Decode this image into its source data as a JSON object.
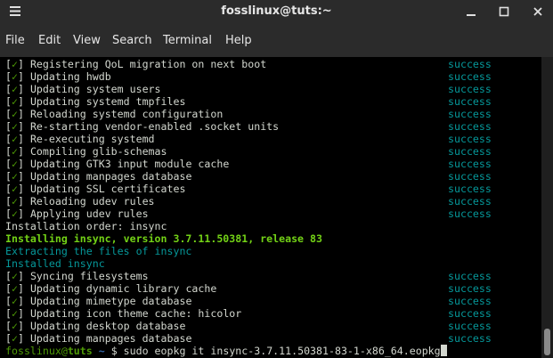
{
  "window": {
    "title": "fosslinux@tuts:~",
    "icons": {
      "menu": "hamburger-menu-icon",
      "minimize": "minimize-icon",
      "maximize": "maximize-icon",
      "close": "close-icon"
    }
  },
  "menubar": {
    "items": [
      "File",
      "Edit",
      "View",
      "Search",
      "Terminal",
      "Help"
    ]
  },
  "terminal": {
    "colors": {
      "status": "#06989a",
      "check": "#4e9a06",
      "highlight": "#73d216",
      "text": "#d3d7cf",
      "background": "#000000"
    },
    "lines_block1": [
      {
        "check": "✓",
        "text": "Registering QoL migration on next boot",
        "status": "success"
      },
      {
        "check": "✓",
        "text": "Updating hwdb",
        "status": "success"
      },
      {
        "check": "✓",
        "text": "Updating system users",
        "status": "success"
      },
      {
        "check": "✓",
        "text": "Updating systemd tmpfiles",
        "status": "success"
      },
      {
        "check": "✓",
        "text": "Reloading systemd configuration",
        "status": "success"
      },
      {
        "check": "✓",
        "text": "Re-starting vendor-enabled .socket units",
        "status": "success"
      },
      {
        "check": "✓",
        "text": "Re-executing systemd",
        "status": "success"
      },
      {
        "check": "✓",
        "text": "Compiling glib-schemas",
        "status": "success"
      },
      {
        "check": "✓",
        "text": "Updating GTK3 input module cache",
        "status": "success"
      },
      {
        "check": "✓",
        "text": "Updating manpages database",
        "status": "success"
      },
      {
        "check": "✓",
        "text": "Updating SSL certificates",
        "status": "success"
      },
      {
        "check": "✓",
        "text": "Reloading udev rules",
        "status": "success"
      },
      {
        "check": "✓",
        "text": "Applying udev rules",
        "status": "success"
      }
    ],
    "install_order": "Installation order: insync",
    "installing": "Installing insync, version 3.7.11.50381, release 83",
    "extracting": "Extracting the files of insync",
    "installed": "Installed insync",
    "lines_block2": [
      {
        "check": "✓",
        "text": "Syncing filesystems",
        "status": "success"
      },
      {
        "check": "✓",
        "text": "Updating dynamic library cache",
        "status": "success"
      },
      {
        "check": "✓",
        "text": "Updating mimetype database",
        "status": "success"
      },
      {
        "check": "✓",
        "text": "Updating icon theme cache: hicolor",
        "status": "success"
      },
      {
        "check": "✓",
        "text": "Updating desktop database",
        "status": "success"
      },
      {
        "check": "✓",
        "text": "Updating manpages database",
        "status": "success"
      }
    ],
    "prompt": {
      "user": "fosslinux",
      "at": "@",
      "host": "tuts",
      "path": "~",
      "symbol": "$",
      "command": "sudo eopkg it insync-3.7.11.50381-83-1-x86_64.eopkg"
    }
  }
}
